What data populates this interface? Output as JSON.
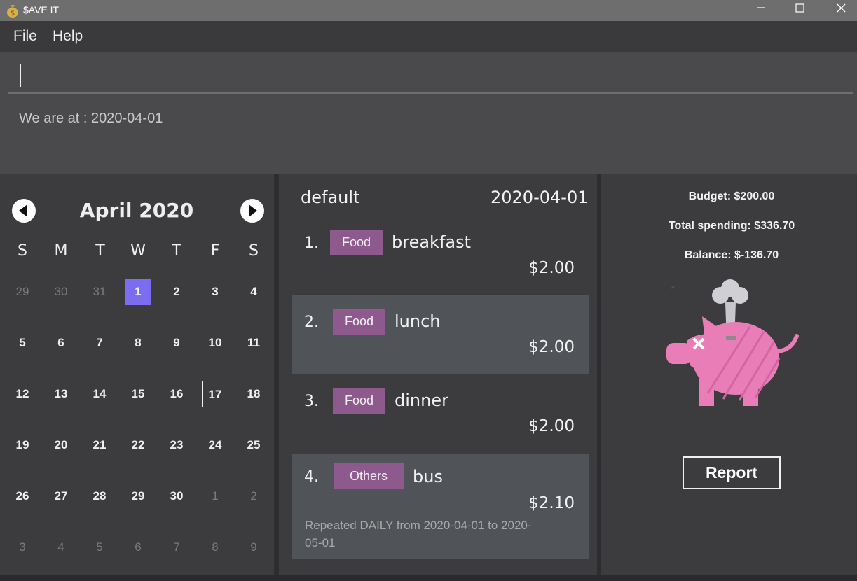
{
  "window": {
    "title": "$AVE IT"
  },
  "menu": {
    "file": "File",
    "help": "Help"
  },
  "command": {
    "value": "",
    "result": "We are at : 2020-04-01"
  },
  "calendar": {
    "month_label": "April  2020",
    "headers": [
      "S",
      "M",
      "T",
      "W",
      "T",
      "F",
      "S"
    ],
    "weeks": [
      [
        "29",
        "30",
        "31",
        "1",
        "2",
        "3",
        "4"
      ],
      [
        "5",
        "6",
        "7",
        "8",
        "9",
        "10",
        "11"
      ],
      [
        "12",
        "13",
        "14",
        "15",
        "16",
        "17",
        "18"
      ],
      [
        "19",
        "20",
        "21",
        "22",
        "23",
        "24",
        "25"
      ],
      [
        "26",
        "27",
        "28",
        "29",
        "30",
        "1",
        "2"
      ],
      [
        "3",
        "4",
        "5",
        "6",
        "7",
        "8",
        "9"
      ]
    ],
    "today": "1",
    "selected": "17",
    "colors": {
      "today": "#7b6cf0"
    }
  },
  "expenses": {
    "list_name": "default",
    "date": "2020-04-01",
    "items": [
      {
        "index": "1.",
        "tag": "Food",
        "description": "breakfast",
        "amount": "$2.00",
        "repeat": ""
      },
      {
        "index": "2.",
        "tag": "Food",
        "description": "lunch",
        "amount": "$2.00",
        "repeat": ""
      },
      {
        "index": "3.",
        "tag": "Food",
        "description": "dinner",
        "amount": "$2.00",
        "repeat": ""
      },
      {
        "index": "4.",
        "tag": "Others",
        "description": "bus",
        "amount": "$2.10",
        "repeat": "Repeated DAILY from 2020-04-01 to 2020-05-01"
      }
    ],
    "colors": {
      "tag": "#8e5a8e"
    }
  },
  "budget": {
    "budget": "Budget: $200.00",
    "total_spending": "Total spending: $336.70",
    "balance": "Balance: $-136.70",
    "image_icon": "broken-piggy-bank-icon",
    "report_label": "Report"
  }
}
